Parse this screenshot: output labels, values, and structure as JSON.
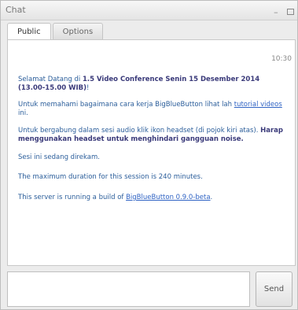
{
  "window": {
    "title": "Chat",
    "minimize_glyph": "–"
  },
  "tabs": [
    {
      "label": "Public",
      "active": true
    },
    {
      "label": "Options",
      "active": false
    }
  ],
  "messages": {
    "time": "10:30",
    "welcome_prefix": "Selamat Datang di ",
    "welcome_bold": "1.5 Video Conference Senin 15 Desember 2014 (13.00-15.00 WIB)",
    "welcome_suffix": "!",
    "help_text": "Untuk memahami bagaimana cara kerja BigBlueButton lihat lah ",
    "help_link": "tutorial videos",
    "help_suffix": " ini.",
    "audio_text": "Untuk bergabung dalam sesi audio klik ikon headset (di pojok kiri atas). ",
    "audio_bold": "Harap menggunakan headset untuk menghindari gangguan noise.",
    "recording": "Sesi ini sedang direkam.",
    "duration": "The maximum duration for this session is 240 minutes.",
    "server_text": "This server is running a build of ",
    "server_link": "BigBlueButton 0.9.0-beta",
    "server_suffix": "."
  },
  "composer": {
    "input_value": "",
    "send_label": "Send"
  },
  "icons": {
    "minimize": "minimize-icon",
    "maximize": "maximize-icon"
  }
}
